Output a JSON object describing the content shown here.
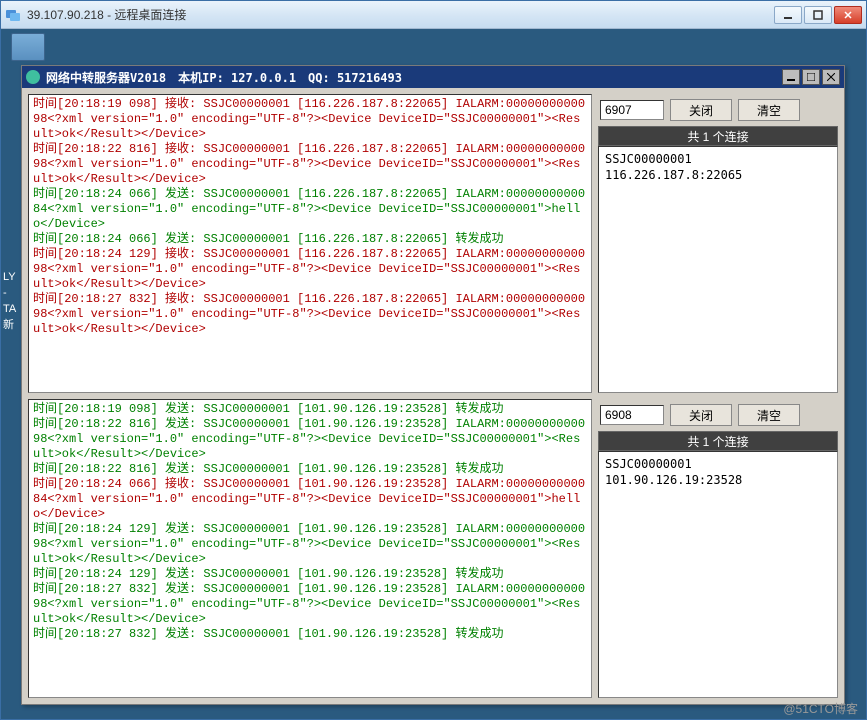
{
  "outer": {
    "title": "39.107.90.218 - 远程桌面连接"
  },
  "inner": {
    "title": "网络中转服务器V2018　本机IP: 127.0.0.1　QQ: 517216493"
  },
  "pane1": {
    "port": "6907",
    "close_label": "关闭",
    "clear_label": "清空",
    "conn_header": "共 1 个连接",
    "conn_item": "SSJC00000001 116.226.187.8:22065",
    "log": [
      {
        "c": "red",
        "t": "时间[20:18:19 098] 接收: SSJC00000001 [116.226.187.8:22065] IALARM:0000000000098<?xml version=\"1.0\" encoding=\"UTF-8\"?><Device DeviceID=\"SSJC00000001\"><Result>ok</Result></Device>"
      },
      {
        "c": "red",
        "t": "时间[20:18:22 816] 接收: SSJC00000001 [116.226.187.8:22065] IALARM:0000000000098<?xml version=\"1.0\" encoding=\"UTF-8\"?><Device DeviceID=\"SSJC00000001\"><Result>ok</Result></Device>"
      },
      {
        "c": "green",
        "t": "时间[20:18:24 066] 发送: SSJC00000001 [116.226.187.8:22065] IALARM:0000000000084<?xml version=\"1.0\" encoding=\"UTF-8\"?><Device DeviceID=\"SSJC00000001\">hello</Device>"
      },
      {
        "c": "green",
        "t": "时间[20:18:24 066] 发送: SSJC00000001 [116.226.187.8:22065] 转发成功"
      },
      {
        "c": "red",
        "t": "时间[20:18:24 129] 接收: SSJC00000001 [116.226.187.8:22065] IALARM:0000000000098<?xml version=\"1.0\" encoding=\"UTF-8\"?><Device DeviceID=\"SSJC00000001\"><Result>ok</Result></Device>"
      },
      {
        "c": "red",
        "t": "时间[20:18:27 832] 接收: SSJC00000001 [116.226.187.8:22065] IALARM:0000000000098<?xml version=\"1.0\" encoding=\"UTF-8\"?><Device DeviceID=\"SSJC00000001\"><Result>ok</Result></Device>"
      }
    ]
  },
  "pane2": {
    "port": "6908",
    "close_label": "关闭",
    "clear_label": "清空",
    "conn_header": "共 1 个连接",
    "conn_item": "SSJC00000001 101.90.126.19:23528",
    "log": [
      {
        "c": "green",
        "t": "时间[20:18:19 098] 发送: SSJC00000001 [101.90.126.19:23528] 转发成功"
      },
      {
        "c": "green",
        "t": "时间[20:18:22 816] 发送: SSJC00000001 [101.90.126.19:23528] IALARM:0000000000098<?xml version=\"1.0\" encoding=\"UTF-8\"?><Device DeviceID=\"SSJC00000001\"><Result>ok</Result></Device>"
      },
      {
        "c": "green",
        "t": "时间[20:18:22 816] 发送: SSJC00000001 [101.90.126.19:23528] 转发成功"
      },
      {
        "c": "red",
        "t": "时间[20:18:24 066] 接收: SSJC00000001 [101.90.126.19:23528] IALARM:0000000000084<?xml version=\"1.0\" encoding=\"UTF-8\"?><Device DeviceID=\"SSJC00000001\">hello</Device>"
      },
      {
        "c": "green",
        "t": "时间[20:18:24 129] 发送: SSJC00000001 [101.90.126.19:23528] IALARM:0000000000098<?xml version=\"1.0\" encoding=\"UTF-8\"?><Device DeviceID=\"SSJC00000001\"><Result>ok</Result></Device>"
      },
      {
        "c": "green",
        "t": "时间[20:18:24 129] 发送: SSJC00000001 [101.90.126.19:23528] 转发成功"
      },
      {
        "c": "green",
        "t": "时间[20:18:27 832] 发送: SSJC00000001 [101.90.126.19:23528] IALARM:0000000000098<?xml version=\"1.0\" encoding=\"UTF-8\"?><Device DeviceID=\"SSJC00000001\"><Result>ok</Result></Device>"
      },
      {
        "c": "green",
        "t": "时间[20:18:27 832] 发送: SSJC00000001 [101.90.126.19:23528] 转发成功"
      }
    ]
  },
  "left_labels": [
    "LY",
    "-",
    "",
    "",
    "TA",
    "",
    "",
    "",
    "新"
  ],
  "watermark": "@51CTO博客"
}
